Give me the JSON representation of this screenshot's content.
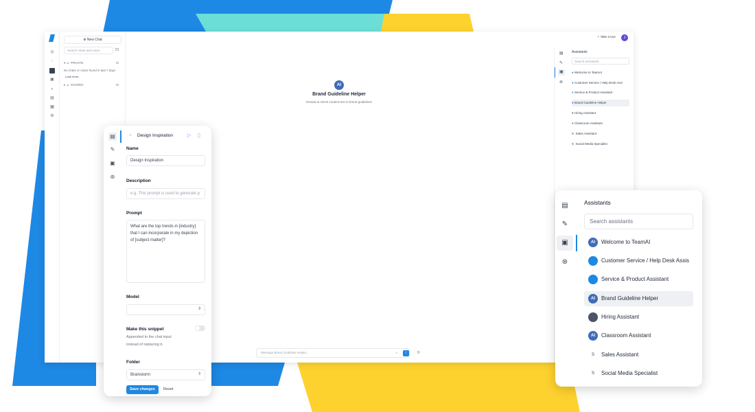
{
  "colors": {
    "blue": "#1e88e5",
    "teal": "#6bdfd7",
    "yellow": "#fdd22f",
    "avatar": "#5b4bdb"
  },
  "main": {
    "new_chat": "New Chat",
    "search_placeholder": "Search chats and notes",
    "private_label": "PRIVATE",
    "no_chats": "No chats or notes found in last 7 days",
    "load_more": "Load more...",
    "shared_label": "SHARED",
    "take_tour": "Take a tour",
    "avatar_initial": "J",
    "center_logo": "AI",
    "center_title": "Brand Guideline Helper",
    "center_subtitle": "Review & check content text to brand guidelines",
    "message_placeholder": "Message Brand Guideline Helper...",
    "assistants_title": "Assistants",
    "assistants_search": "Search assistants",
    "assistants": [
      "Welcome to TeamAI",
      "Customer Service / Help Desk Assi",
      "Service & Product Assistant",
      "Brand Guideline Helper",
      "Hiring Assistant",
      "Classroom Assistant",
      "Sales Assistant",
      "Social Media Specialist"
    ]
  },
  "snippet": {
    "header_title": "Design Inspiration",
    "name_label": "Name",
    "name_value": "Design Inspiration",
    "description_label": "Description",
    "description_placeholder": "e.g. This prompt is used to generate p",
    "prompt_label": "Prompt",
    "prompt_value": "What are the top trends in [industry] that I can incorporate in my depiction of [subject matter]?",
    "model_label": "Model",
    "snippet_label": "Make this snippet",
    "snippet_help_1": "Appended to the chat input",
    "snippet_help_2": "instead of replacing it.",
    "folder_label": "Folder",
    "folder_value": "Brainstorm",
    "save_label": "Save changes",
    "reset_label": "Reset"
  },
  "assistants_panel": {
    "title": "Assistants",
    "search_placeholder": "Search assistants",
    "items": [
      {
        "name": "Welcome to TeamAI",
        "icon": "ai-logo-icon",
        "badge": "AI"
      },
      {
        "name": "Customer Service / Help Desk Assis",
        "icon": "support-avatar-icon",
        "badge": ""
      },
      {
        "name": "Service & Product Assistant",
        "icon": "product-avatar-icon",
        "badge": ""
      },
      {
        "name": "Brand Guideline Helper",
        "icon": "ai-logo-icon",
        "badge": "AI",
        "selected": true
      },
      {
        "name": "Hiring Assistant",
        "icon": "robot-avatar-icon",
        "badge": ""
      },
      {
        "name": "Classroom Assistant",
        "icon": "ai-logo-icon",
        "badge": "AI"
      },
      {
        "name": "Sales Assistant",
        "icon": "letter-s-icon",
        "badge": "S"
      },
      {
        "name": "Social Media Specialist",
        "icon": "letter-s-icon",
        "badge": "S"
      }
    ]
  }
}
